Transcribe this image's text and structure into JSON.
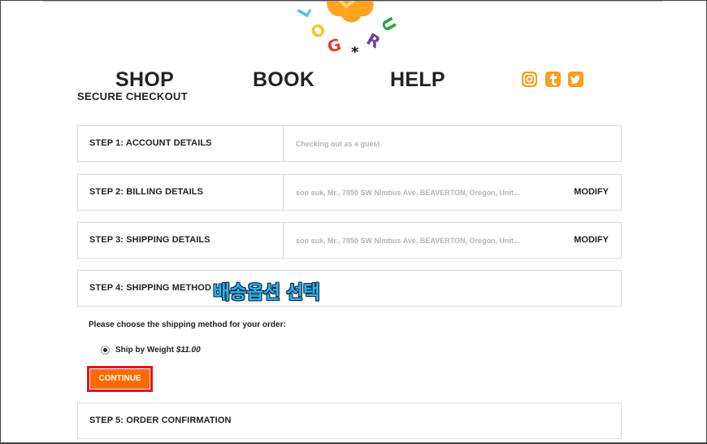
{
  "logo": {
    "letters": [
      "L",
      "O",
      "G",
      "*",
      "R",
      "U"
    ],
    "colors": {
      "blob": "#ffa321",
      "cyan": "#4bc3e3",
      "yellow": "#f7c627",
      "red": "#e8343a",
      "purple": "#6b3fa6",
      "green": "#2aa744",
      "star": "#111111"
    }
  },
  "nav": {
    "shop": "SHOP",
    "book": "BOOK",
    "help": "HELP"
  },
  "social": {
    "icons": [
      "instagram-icon",
      "tumblr-icon",
      "twitter-icon"
    ],
    "color": "#f4a020"
  },
  "page": {
    "subtitle": "SECURE CHECKOUT"
  },
  "steps": [
    {
      "label": "STEP 1: ACCOUNT DETAILS",
      "summary": "Checking out as a guest",
      "action": ""
    },
    {
      "label": "STEP 2: BILLING DETAILS",
      "summary": "soo suk, Mr., 7850 SW Nimbus Ave, BEAVERTON, Oregon, Unit...",
      "action": "MODIFY"
    },
    {
      "label": "STEP 3: SHIPPING DETAILS",
      "summary": "soo suk, Mr., 7850 SW Nimbus Ave, BEAVERTON, Oregon, Unit...",
      "action": "MODIFY"
    },
    {
      "label": "STEP 4: SHIPPING METHOD",
      "summary": "",
      "action": ""
    },
    {
      "label": "STEP 5: ORDER CONFIRMATION",
      "summary": "",
      "action": ""
    }
  ],
  "annotation": {
    "text": "배송옵션 선택",
    "color": "#2ab5e8"
  },
  "shipping": {
    "prompt": "Please choose the shipping method for your order:",
    "option_label": "Ship by Weight",
    "option_price": "$11.00",
    "selected": true
  },
  "continue": {
    "label": "CONTINUE",
    "color": "#ff6a00",
    "highlight": "#f10f1a"
  }
}
